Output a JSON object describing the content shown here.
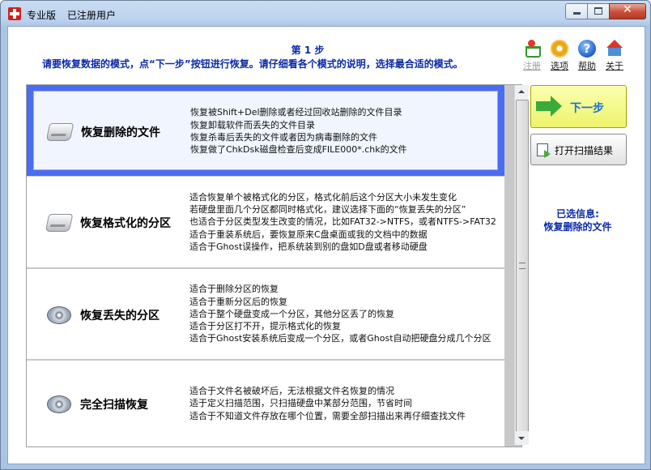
{
  "window": {
    "title_parts": [
      "专业版",
      "已注册用户"
    ],
    "controls": {
      "minimize": "minimize",
      "maximize": "maximize",
      "close": "✕"
    }
  },
  "header": {
    "step_title": "第 1 步",
    "instruction": "请要恢复数据的模式，点“下一步”按钮进行恢复。请仔细看各个模式的说明，选择最合适的模式。"
  },
  "toolbar": [
    {
      "label": "注册",
      "icon": "cart-icon",
      "disabled": true
    },
    {
      "label": "选项",
      "icon": "gear-icon",
      "disabled": false
    },
    {
      "label": "帮助",
      "icon": "help-icon",
      "disabled": false
    },
    {
      "label": "关于",
      "icon": "home-icon",
      "disabled": false
    }
  ],
  "modes": [
    {
      "name": "恢复删除的文件",
      "icon": "disk-icon",
      "selected": true,
      "desc": [
        "恢复被Shift+Del删除或者经过回收站删除的文件目录",
        "恢复卸载软件而丢失的文件目录",
        "恢复杀毒后丢失的文件或者因为病毒删除的文件",
        "恢复做了ChkDsk磁盘检查后变成FILE000*.chk的文件"
      ]
    },
    {
      "name": "恢复格式化的分区",
      "icon": "disk-icon",
      "selected": false,
      "desc": [
        "适合恢复单个被格式化的分区，格式化前后这个分区大小未发生变化",
        "若硬盘里面几个分区都同时格式化，建议选择下面的“恢复丢失的分区”",
        "也适合于分区类型发生改变的情况，比如FAT32->NTFS，或者NTFS->FAT32",
        "适合于重装系统后，要恢复原来C盘桌面或我的文档中的数据",
        "适合于Ghost误操作，把系统装到别的盘如D盘或者移动硬盘"
      ]
    },
    {
      "name": "恢复丢失的分区",
      "icon": "cd-icon",
      "selected": false,
      "desc": [
        "适合于删除分区的恢复",
        "适合于重新分区后的恢复",
        "适合于整个硬盘变成一个分区，其他分区丢了的恢复",
        "适合于分区打不开，提示格式化的恢复",
        "适合于Ghost安装系统后变成一个分区，或者Ghost自动把硬盘分成几个分区"
      ]
    },
    {
      "name": "完全扫描恢复",
      "icon": "cd-icon",
      "selected": false,
      "desc": [
        "适合于文件名被破坏后，无法根据文件名恢复的情况",
        "适于定义扫描范围，只扫描硬盘中某部分范围，节省时间",
        "适合于不知道文件存放在哪个位置，需要全部扫描出来再仔细查找文件"
      ]
    }
  ],
  "actions": {
    "next_label": "下一步",
    "open_scan_label": "打开扫描结果"
  },
  "selection": {
    "heading": "已选信息:",
    "value": "恢复删除的文件"
  }
}
